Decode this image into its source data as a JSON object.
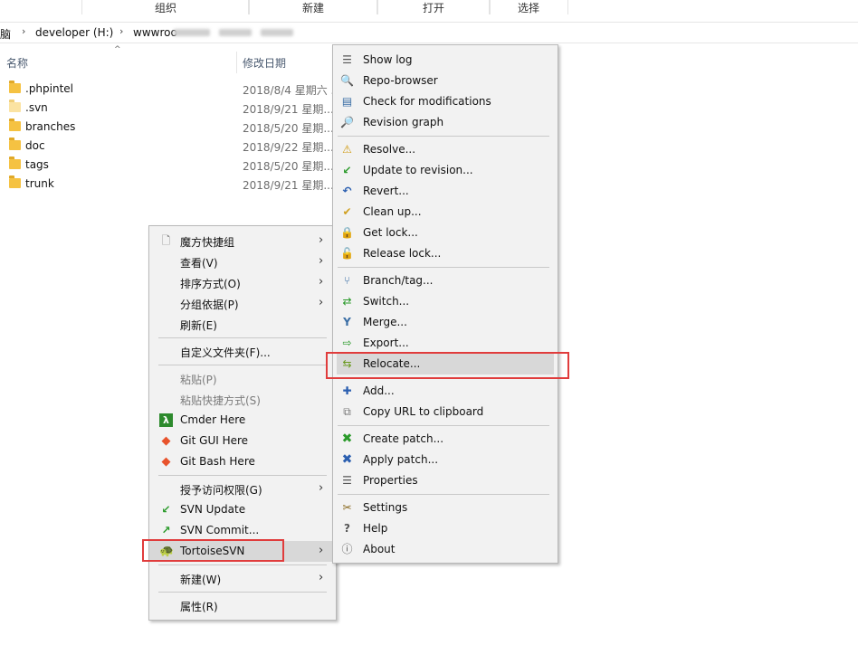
{
  "ribbon": {
    "groups": [
      "组织",
      "新建",
      "打开",
      "选择"
    ]
  },
  "address": {
    "crumbs": [
      "脑",
      "developer (H:)",
      "wwwroo"
    ]
  },
  "columns": {
    "name": "名称",
    "modified": "修改日期"
  },
  "files": [
    {
      "name": ".phpintel",
      "date": "2018/8/4 星期六 ..."
    },
    {
      "name": ".svn",
      "date": "2018/9/21 星期..."
    },
    {
      "name": "branches",
      "date": "2018/5/20 星期..."
    },
    {
      "name": "doc",
      "date": "2018/9/22 星期..."
    },
    {
      "name": "tags",
      "date": "2018/5/20 星期..."
    },
    {
      "name": "trunk",
      "date": "2018/9/21 星期..."
    }
  ],
  "context_menu": {
    "items": [
      {
        "label": "魔方快捷组",
        "icon": "page-icon"
      },
      {
        "label": "查看(V)"
      },
      {
        "label": "排序方式(O)"
      },
      {
        "label": "分组依据(P)"
      },
      {
        "label": "刷新(E)"
      },
      {
        "label": "自定义文件夹(F)..."
      },
      {
        "label": "粘贴(P)"
      },
      {
        "label": "粘贴快捷方式(S)"
      },
      {
        "label": "Cmder Here",
        "icon": "lambda-icon"
      },
      {
        "label": "Git GUI Here",
        "icon": "git-icon"
      },
      {
        "label": "Git Bash Here",
        "icon": "git-icon"
      },
      {
        "label": "授予访问权限(G)"
      },
      {
        "label": "SVN Update",
        "icon": "svn-update-icon"
      },
      {
        "label": "SVN Commit...",
        "icon": "svn-commit-icon"
      },
      {
        "label": "TortoiseSVN",
        "icon": "tortoise-icon"
      },
      {
        "label": "新建(W)"
      },
      {
        "label": "属性(R)"
      }
    ]
  },
  "svn_menu": {
    "items": [
      {
        "label": "Show log",
        "icon": "show-log-icon"
      },
      {
        "label": "Repo-browser",
        "icon": "repo-browser-icon"
      },
      {
        "label": "Check for modifications",
        "icon": "check-modifications-icon"
      },
      {
        "label": "Revision graph",
        "icon": "revision-graph-icon"
      },
      {
        "label": "Resolve...",
        "icon": "resolve-icon"
      },
      {
        "label": "Update to revision...",
        "icon": "update-revision-icon"
      },
      {
        "label": "Revert...",
        "icon": "revert-icon"
      },
      {
        "label": "Clean up...",
        "icon": "cleanup-icon"
      },
      {
        "label": "Get lock...",
        "icon": "lock-icon"
      },
      {
        "label": "Release lock...",
        "icon": "unlock-icon"
      },
      {
        "label": "Branch/tag...",
        "icon": "branch-icon"
      },
      {
        "label": "Switch...",
        "icon": "switch-icon"
      },
      {
        "label": "Merge...",
        "icon": "merge-icon"
      },
      {
        "label": "Export...",
        "icon": "export-icon"
      },
      {
        "label": "Relocate...",
        "icon": "relocate-icon"
      },
      {
        "label": "Add...",
        "icon": "add-icon"
      },
      {
        "label": "Copy URL to clipboard",
        "icon": "copy-url-icon"
      },
      {
        "label": "Create patch...",
        "icon": "create-patch-icon"
      },
      {
        "label": "Apply patch...",
        "icon": "apply-patch-icon"
      },
      {
        "label": "Properties",
        "icon": "properties-icon"
      },
      {
        "label": "Settings",
        "icon": "settings-icon"
      },
      {
        "label": "Help",
        "icon": "help-icon"
      },
      {
        "label": "About",
        "icon": "about-icon"
      }
    ]
  },
  "colors": {
    "highlight_box": "#e03c3c",
    "menu_bg": "#f2f2f2",
    "folder": "#f5c242"
  }
}
